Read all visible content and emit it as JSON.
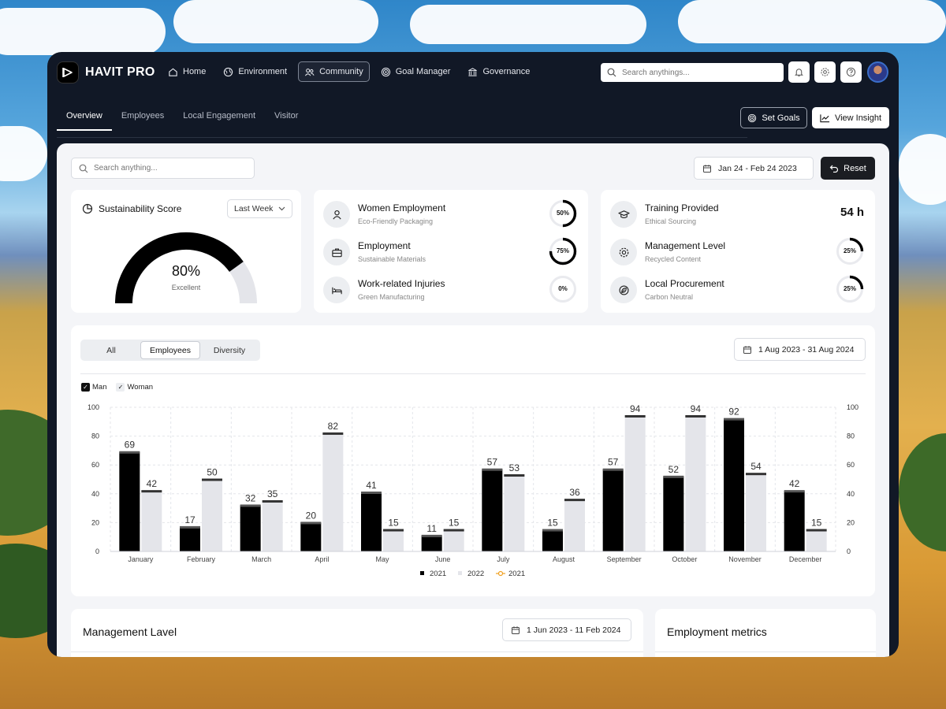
{
  "app": {
    "name": "HAVIT PRO"
  },
  "nav": {
    "items": [
      {
        "label": "Home",
        "icon": "home-icon"
      },
      {
        "label": "Environment",
        "icon": "globe-icon"
      },
      {
        "label": "Community",
        "icon": "users-icon",
        "active": true
      },
      {
        "label": "Goal Manager",
        "icon": "target-icon"
      },
      {
        "label": "Governance",
        "icon": "bank-icon"
      }
    ],
    "search_placeholder": "Search anythings..."
  },
  "subtabs": [
    "Overview",
    "Employees",
    "Local Engagement",
    "Visitor"
  ],
  "actions": {
    "set_goals": "Set Goals",
    "view_insight": "View Insight"
  },
  "toolbar": {
    "search_placeholder": "Search anything...",
    "date_range": "Jan 24 - Feb 24 2023",
    "reset": "Reset"
  },
  "score": {
    "title": "Sustainability Score",
    "period": "Last Week",
    "value": "80%",
    "value_num": 80,
    "label": "Excellent"
  },
  "metrics_left": [
    {
      "title": "Women Employment",
      "sub": "Eco-Friendly Packaging",
      "ring": "50%",
      "ring_value": 50
    },
    {
      "title": "Employment",
      "sub": "Sustainable Materials",
      "ring": "75%",
      "ring_value": 75
    },
    {
      "title": "Work-related Injuries",
      "sub": "Green Manufacturing",
      "ring": "0%",
      "ring_value": 0
    }
  ],
  "metrics_right": [
    {
      "title": "Training Provided",
      "sub": "Ethical Sourcing",
      "value": "54 h"
    },
    {
      "title": "Management Level",
      "sub": "Recycled Content",
      "ring": "25%",
      "ring_value": 25
    },
    {
      "title": "Local Procurement",
      "sub": "Carbon Neutral",
      "ring": "25%",
      "ring_value": 25
    }
  ],
  "chart_card": {
    "segments": [
      "All",
      "Employees",
      "Diversity"
    ],
    "active_segment": "Employees",
    "date_range": "1 Aug 2023 - 31 Aug 2024",
    "filters": [
      "Man",
      "Woman"
    ]
  },
  "chart_data": {
    "type": "bar",
    "categories": [
      "January",
      "February",
      "March",
      "April",
      "May",
      "June",
      "July",
      "August",
      "September",
      "October",
      "November",
      "December"
    ],
    "series": [
      {
        "name": "2021",
        "values": [
          69,
          17,
          32,
          20,
          41,
          11,
          57,
          15,
          57,
          52,
          92,
          42
        ],
        "color": "#000000"
      },
      {
        "name": "2022",
        "values": [
          42,
          50,
          35,
          82,
          15,
          15,
          53,
          36,
          94,
          94,
          54,
          15
        ],
        "color": "#e4e5ea"
      }
    ],
    "legend_extra": {
      "name": "2021",
      "color": "#f0a020"
    },
    "ylim": [
      0,
      100
    ],
    "yticks": [
      "0",
      "20",
      "40",
      "60",
      "80",
      "100"
    ],
    "grid": true,
    "legend": "bottom-center"
  },
  "bottom": {
    "management_title": "Management Lavel",
    "management_date": "1 Jun 2023 - 11 Feb 2024",
    "employment_title": "Employment metrics"
  }
}
